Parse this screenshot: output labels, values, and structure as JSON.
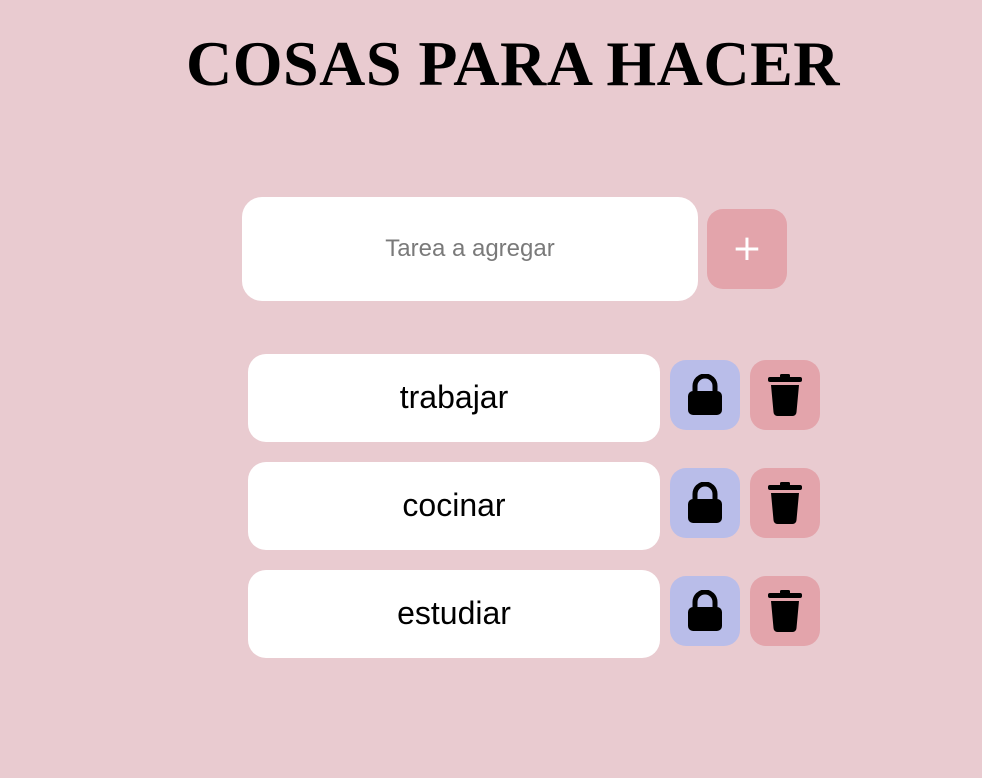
{
  "page": {
    "title": "COSAS PARA HACER"
  },
  "input": {
    "placeholder": "Tarea a agregar",
    "value": ""
  },
  "add_button": {
    "label": "+"
  },
  "tasks": [
    {
      "label": "trabajar",
      "lock_icon": "lock-icon",
      "delete_icon": "trash-icon"
    },
    {
      "label": "cocinar",
      "lock_icon": "lock-icon",
      "delete_icon": "trash-icon"
    },
    {
      "label": "estudiar",
      "lock_icon": "lock-icon",
      "delete_icon": "trash-icon"
    }
  ],
  "colors": {
    "background": "#e9cbd0",
    "add_button": "#e3a4ab",
    "lock_button": "#b9bde9",
    "delete_button": "#e3a4ab",
    "card": "#ffffff"
  }
}
